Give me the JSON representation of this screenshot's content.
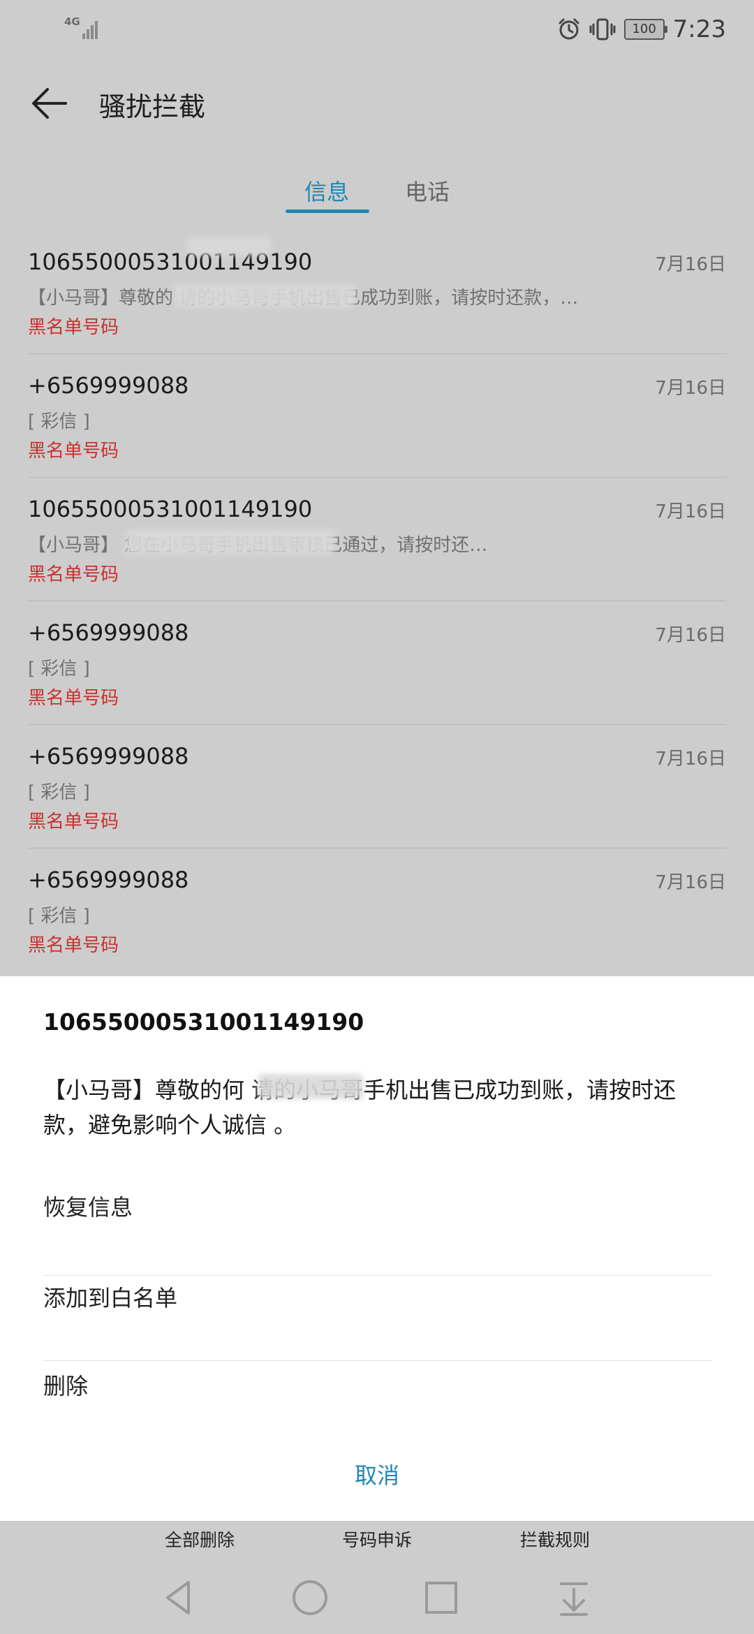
{
  "status_bar": {
    "network": "4G",
    "battery": "100",
    "time": "7:23",
    "icons": [
      "signal-icon",
      "alarm-icon",
      "vibrate-icon",
      "battery-icon"
    ]
  },
  "header": {
    "title": "骚扰拦截"
  },
  "tabs": [
    {
      "label": "信息",
      "active": true
    },
    {
      "label": "电话",
      "active": false
    }
  ],
  "messages": [
    {
      "number": "10655000531001149190",
      "date": "7月16日",
      "preview": "【小马哥】尊敬的                 请的小马哥手机出售已成功到账，请按时还款，…",
      "tag": "黑名单号码"
    },
    {
      "number": "+6569999088",
      "date": "7月16日",
      "preview": "[ 彩信 ]",
      "tag": "黑名单号码"
    },
    {
      "number": "10655000531001149190",
      "date": "7月16日",
      "preview": "【小马哥】                      您在小马哥手机出售审核已通过，请按时还…",
      "tag": "黑名单号码"
    },
    {
      "number": "+6569999088",
      "date": "7月16日",
      "preview": "[ 彩信 ]",
      "tag": "黑名单号码"
    },
    {
      "number": "+6569999088",
      "date": "7月16日",
      "preview": "[ 彩信 ]",
      "tag": "黑名单号码"
    },
    {
      "number": "+6569999088",
      "date": "7月16日",
      "preview": "[ 彩信 ]",
      "tag": "黑名单号码"
    }
  ],
  "sheet": {
    "number": "10655000531001149190",
    "body": "【小马哥】尊敬的何            请的小马哥手机出售已成功到账，请按时还款，避免影响个人诚信 。",
    "options": [
      "恢复信息",
      "添加到白名单",
      "删除"
    ],
    "cancel": "取消"
  },
  "bottom_actions": [
    "全部删除",
    "号码申诉",
    "拦截规则"
  ],
  "colors": {
    "accent": "#1f86b4",
    "blacklist_tag": "#c9302c",
    "scrim_background": "#cdcdcd",
    "sheet_background": "#ffffff"
  }
}
